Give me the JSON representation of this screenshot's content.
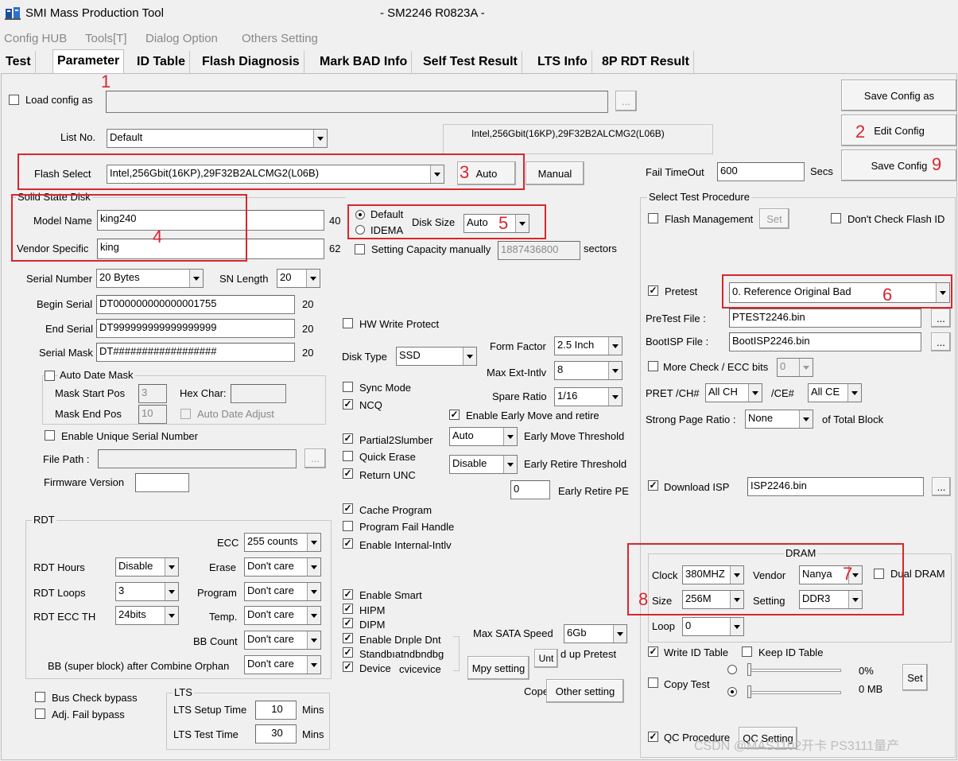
{
  "window": {
    "title": "SMI Mass Production Tool",
    "subtitle": "- SM2246 R0823A -"
  },
  "menu": [
    "Config HUB",
    "Tools[T]",
    "Dialog Option",
    "Others Setting"
  ],
  "tabs": [
    "Test",
    "Parameter",
    "ID Table",
    "Flash Diagnosis",
    "Mark BAD Info",
    "Self Test Result",
    "LTS Info",
    "8P RDT Result"
  ],
  "top": {
    "load_config_label": "Load config as",
    "browse": "...",
    "list_no_label": "List No.",
    "list_no_value": "Default",
    "flash_info": "Intel,256Gbit(16KP),29F32B2ALCMG2(L06B)",
    "flash_select_label": "Flash Select",
    "flash_select_value": "Intel,256Gbit(16KP),29F32B2ALCMG2(L06B)",
    "auto_btn": "Auto",
    "manual_btn": "Manual",
    "fail_timeout_label": "Fail TimeOut",
    "fail_timeout_value": "600",
    "secs": "Secs",
    "save_config_as": "Save Config as",
    "edit_config": "Edit Config",
    "save_config": "Save Config"
  },
  "ssd": {
    "group_label": "Solid State Disk",
    "model_name_label": "Model Name",
    "model_name_value": "king240",
    "model_len": "40",
    "vendor_label": "Vendor Specific",
    "vendor_value": "king",
    "vendor_len": "62",
    "default_label": "Default",
    "idema_label": "IDEMA",
    "disk_size_label": "Disk Size",
    "disk_size_value": "Auto",
    "setting_capacity_label": "Setting Capacity manually",
    "capacity_value": "1887436800",
    "sectors": "sectors",
    "serial_number_label": "Serial Number",
    "serial_number_value": "20 Bytes",
    "sn_length_label": "SN Length",
    "sn_length_value": "20",
    "begin_serial_label": "Begin Serial",
    "begin_serial_value": "DT000000000000001755",
    "begin_len": "20",
    "end_serial_label": "End Serial",
    "end_serial_value": "DT999999999999999999",
    "end_len": "20",
    "serial_mask_label": "Serial Mask",
    "serial_mask_value": "DT##################",
    "mask_len": "20",
    "auto_date_mask": "Auto Date Mask",
    "mask_start_pos_label": "Mask Start Pos",
    "mask_start_pos": "3",
    "hex_char_label": "Hex Char:",
    "mask_end_pos_label": "Mask End Pos",
    "mask_end_pos": "10",
    "auto_date_adjust": "Auto Date Adjust",
    "enable_unique_serial": "Enable Unique Serial Number",
    "file_path_label": "File Path :",
    "firmware_version_label": "Firmware Version"
  },
  "rdt": {
    "group_label": "RDT",
    "ecc_label": "ECC",
    "ecc_value": "255 counts",
    "rdt_hours_label": "RDT Hours",
    "rdt_hours_value": "Disable",
    "erase_label": "Erase",
    "erase_value": "Don't care",
    "rdt_loops_label": "RDT Loops",
    "rdt_loops_value": "3",
    "program_label": "Program",
    "program_value": "Don't care",
    "rdt_ecc_th_label": "RDT ECC TH",
    "rdt_ecc_th_value": "24bits",
    "temp_label": "Temp.",
    "temp_value": "Don't care",
    "bb_count_label": "BB Count",
    "bb_count_value": "Don't care",
    "bb_orphan_label": "BB (super block) after Combine Orphan",
    "bb_orphan_value": "Don't care"
  },
  "bottom_left": {
    "bus_check": "Bus Check bypass",
    "adj_fail": "Adj. Fail bypass",
    "lts_label": "LTS",
    "lts_setup_label": "LTS Setup Time",
    "lts_setup_value": "10",
    "lts_test_label": "LTS Test Time",
    "lts_test_value": "30",
    "mins": "Mins"
  },
  "middle": {
    "hw_write_protect": "HW Write Protect",
    "disk_type_label": "Disk Type",
    "disk_type_value": "SSD",
    "form_factor_label": "Form Factor",
    "form_factor_value": "2.5 Inch",
    "max_ext_label": "Max Ext-Intlv",
    "max_ext_value": "8",
    "sync_mode": "Sync Mode",
    "ncq": "NCQ",
    "spare_ratio_label": "Spare Ratio",
    "spare_ratio_value": "1/16",
    "early_move_retire": "Enable Early Move and retire",
    "partial2slumber": "Partial2Slumber",
    "early_move_value": "Auto",
    "early_move_label": "Early Move Threshold",
    "quick_erase": "Quick Erase",
    "early_retire_value": "Disable",
    "early_retire_label": "Early Retire Threshold",
    "return_unc": "Return UNC",
    "early_retire_pe_value": "0",
    "early_retire_pe_label": "Early Retire PE",
    "cache_program": "Cache Program",
    "program_fail_handle": "Program Fail Handle",
    "enable_internal": "Enable Internal-Intlv",
    "enable_smart": "Enable Smart",
    "hipm": "HIPM",
    "dipm": "DIPM",
    "enable_dripple": "Enable Drıple Dnt",
    "standby": "Standbıatndbndbg",
    "device": "Device",
    "device_overlap": "cvicevice",
    "max_sata_label": "Max SATA Speed",
    "max_sata_value": "6Gb",
    "unt": "Unt",
    "pretest_setup": "d up Pretest",
    "mpy_setting": "Mpy setting",
    "other_setting": "Other setting",
    "cope": "Cope"
  },
  "procedure": {
    "group_label": "Select Test Procedure",
    "flash_management": "Flash Management",
    "set": "Set",
    "dont_check_flash_id": "Don't Check Flash ID",
    "pretest_label": "Pretest",
    "pretest_value": "0. Reference Original Bad",
    "pretest_file_label": "PreTest File :",
    "pretest_file": "PTEST2246.bin",
    "bootisp_label": "BootISP File :",
    "bootisp_file": "BootISP2246.bin",
    "more_check": "More Check / ECC bits",
    "more_check_value": "0",
    "pret_ch_label": "PRET /CH#",
    "pret_ch_value": "All CH",
    "ce_label": "/CE#",
    "ce_value": "All CE",
    "strong_page_label": "Strong Page Ratio :",
    "strong_page_value": "None",
    "of_total": "of Total Block",
    "download_isp": "Download ISP",
    "isp_file": "ISP2246.bin"
  },
  "dram": {
    "group_label": "DRAM",
    "clock_label": "Clock",
    "clock_value": "380MHZ",
    "vendor_label": "Vendor",
    "vendor_value": "Nanya",
    "dual_dram": "Dual DRAM",
    "size_label": "Size",
    "size_value": "256M",
    "setting_label": "Setting",
    "setting_value": "DDR3",
    "loop_label": "Loop",
    "loop_value": "0"
  },
  "bottom_right": {
    "write_id_table": "Write ID Table",
    "keep_id_table": "Keep ID Table",
    "copy_test": "Copy Test",
    "pct": "0%",
    "mb": "0 MB",
    "set": "Set",
    "qc_procedure": "QC Procedure",
    "qc_setting": "QC Setting"
  },
  "annotations": [
    "1",
    "2",
    "3",
    "4",
    "5",
    "6",
    "7",
    "8",
    "9"
  ],
  "watermark": "CSDN @MAS1102开卡 PS3111量产",
  "colors": {
    "annotation": "#d8262e",
    "icon_blue": "#1a4fa0"
  }
}
